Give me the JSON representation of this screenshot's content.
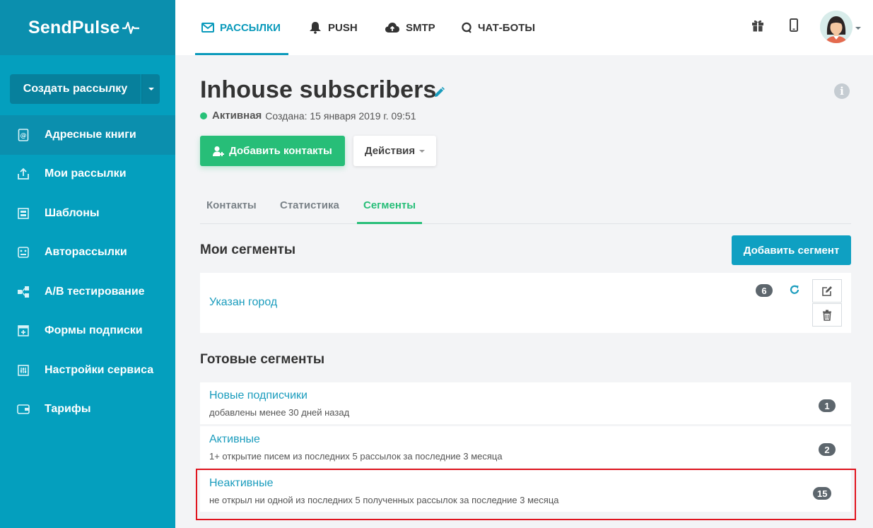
{
  "brand": {
    "name": "SendPulse"
  },
  "sidebar": {
    "create_button": "Создать рассылку",
    "items": [
      {
        "label": "Адресные книги",
        "icon": "address-book-icon",
        "active": true
      },
      {
        "label": "Мои рассылки",
        "icon": "mailing-upload-icon",
        "active": false
      },
      {
        "label": "Шаблоны",
        "icon": "templates-icon",
        "active": false
      },
      {
        "label": "Авторассылки",
        "icon": "automation-icon",
        "active": false
      },
      {
        "label": "A/B тестирование",
        "icon": "ab-test-icon",
        "active": false
      },
      {
        "label": "Формы подписки",
        "icon": "subscription-form-icon",
        "active": false
      },
      {
        "label": "Настройки сервиса",
        "icon": "settings-sliders-icon",
        "active": false
      },
      {
        "label": "Тарифы",
        "icon": "wallet-icon",
        "active": false
      }
    ]
  },
  "topnav": {
    "tabs": [
      {
        "label": "РАССЫЛКИ",
        "icon": "envelope-icon",
        "active": true
      },
      {
        "label": "PUSH",
        "icon": "bell-icon",
        "active": false
      },
      {
        "label": "SMTP",
        "icon": "cloud-upload-icon",
        "active": false
      },
      {
        "label": "ЧАТ-БОТЫ",
        "icon": "chat-icon",
        "active": false
      }
    ],
    "right_icons": [
      "gift-icon",
      "mobile-icon",
      "avatar"
    ]
  },
  "page": {
    "title": "Inhouse subscribers",
    "status": "Активная",
    "created": "Создана: 15 января 2019 г. 09:51",
    "add_contacts_button": "Добавить контакты",
    "actions_button": "Действия",
    "tabs": [
      {
        "label": "Контакты",
        "active": false
      },
      {
        "label": "Статистика",
        "active": false
      },
      {
        "label": "Сегменты",
        "active": true
      }
    ]
  },
  "my_segments": {
    "title": "Мои сегменты",
    "add_button": "Добавить сегмент",
    "items": [
      {
        "name": "Указан город",
        "count": "6"
      }
    ]
  },
  "ready_segments": {
    "title": "Готовые сегменты",
    "items": [
      {
        "name": "Новые подписчики",
        "description": "добавлены менее 30 дней назад",
        "count": "1"
      },
      {
        "name": "Активные",
        "description": "1+ открытие писем из последних 5 рассылок за последние 3 месяца",
        "count": "2"
      },
      {
        "name": "Неактивные",
        "description": "не открыл ни одной из последних 5 полученных рассылок за последние 3 месяца",
        "count": "15",
        "highlighted": true
      }
    ]
  },
  "colors": {
    "sidebar": "#049fbe",
    "sidebar_dark": "#0b8fae",
    "accent_blue": "#0a9abb",
    "accent_green": "#27be78",
    "highlight_border": "#e0141e"
  }
}
